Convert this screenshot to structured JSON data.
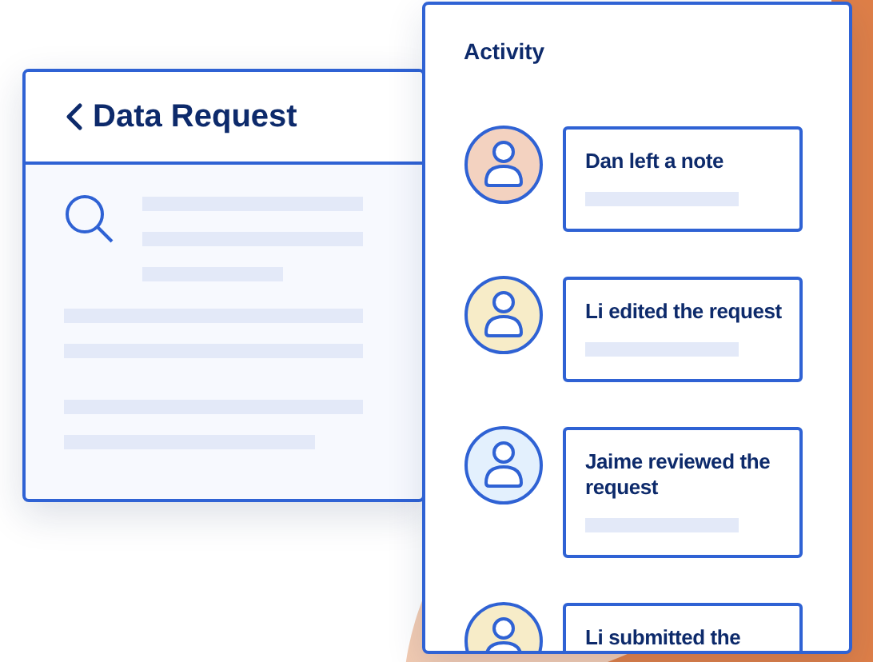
{
  "detail": {
    "title": "Data Request"
  },
  "activity": {
    "title": "Activity",
    "items": [
      {
        "text": "Dan left a note",
        "color": "#f3d2c0"
      },
      {
        "text": "Li edited the request",
        "color": "#f7ecc8"
      },
      {
        "text": "Jaime reviewed the request",
        "color": "#e3f0fd"
      },
      {
        "text": "Li submitted the",
        "color": "#f7ecc8"
      }
    ]
  }
}
